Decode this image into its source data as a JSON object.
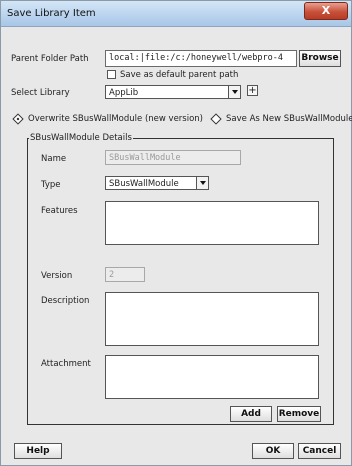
{
  "window": {
    "title": "Save Library Item",
    "close_symbol": "X"
  },
  "parent_folder": {
    "label": "Parent Folder Path",
    "value": "local:|file:/c:/honeywell/webpro-4",
    "browse_label": "Browse",
    "default_checkbox_label": "Save as default parent path"
  },
  "library": {
    "label": "Select Library",
    "selected": "AppLib",
    "add_symbol": "+"
  },
  "save_options": {
    "overwrite_label": "Overwrite SBusWallModule (new version)",
    "save_new_label": "Save As New SBusWallModule",
    "selected": "overwrite"
  },
  "details": {
    "group_title": "SBusWallModule Details",
    "name_label": "Name",
    "name_value": "SBusWallModule",
    "type_label": "Type",
    "type_selected": "SBusWallModule",
    "features_label": "Features",
    "version_label": "Version",
    "version_value": "2",
    "description_label": "Description",
    "attachment_label": "Attachment",
    "add_label": "Add",
    "remove_label": "Remove"
  },
  "footer": {
    "help_label": "Help",
    "ok_label": "OK",
    "cancel_label": "Cancel"
  }
}
